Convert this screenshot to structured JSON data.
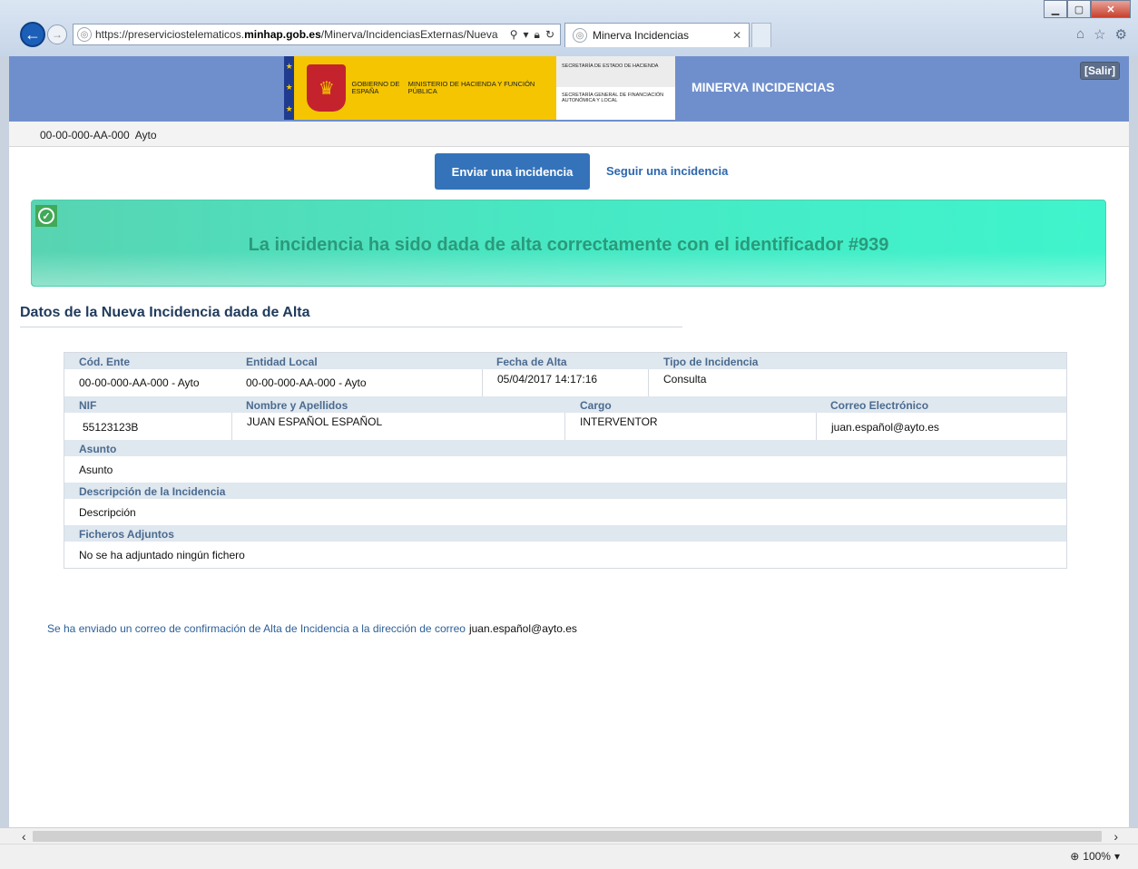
{
  "browser": {
    "url_pre": "https://preserviciostelematicos.",
    "url_host": "minhap.gob.es",
    "url_post": "/Minerva/IncidenciasExternas/Nueva",
    "tab_title": "Minerva Incidencias",
    "zoom": "100%"
  },
  "header": {
    "gobierno": "GOBIERNO DE ESPAÑA",
    "ministerio": "MINISTERIO DE HACIENDA Y FUNCIÓN PÚBLICA",
    "secretaria_estado": "SECRETARÍA DE ESTADO DE HACIENDA",
    "secretaria_general": "SECRETARÍA GENERAL DE FINANCIACIÓN AUTONÓMICA Y LOCAL",
    "app_name": "MINERVA INCIDENCIAS",
    "salir": "[Salir]"
  },
  "user": {
    "code": "00-00-000-AA-000",
    "name": "Ayto"
  },
  "actions": {
    "send_label": "Enviar una incidencia",
    "follow_label": "Seguir una incidencia"
  },
  "alert": {
    "message": "La incidencia ha sido dada de alta correctamente con el identificador #939"
  },
  "section_title": "Datos de la Nueva Incidencia dada de Alta",
  "datos": {
    "h_cod_ente": "Cód. Ente",
    "h_entidad_local": "Entidad Local",
    "h_fecha_alta": "Fecha de Alta",
    "h_tipo": "Tipo de Incidencia",
    "cod_ente": "00-00-000-AA-000 - Ayto",
    "entidad_local": "00-00-000-AA-000 - Ayto",
    "fecha_alta": "05/04/2017 14:17:16",
    "tipo": "Consulta",
    "h_nif": "NIF",
    "h_nombre": "Nombre y Apellidos",
    "h_cargo": "Cargo",
    "h_correo": "Correo Electrónico",
    "nif": "55123123B",
    "nombre": "JUAN ESPAÑOL ESPAÑOL",
    "cargo": "INTERVENTOR",
    "correo": "juan.español@ayto.es",
    "h_asunto": "Asunto",
    "asunto": "Asunto",
    "h_descripcion": "Descripción de la Incidencia",
    "descripcion": "Descripción",
    "h_ficheros": "Ficheros Adjuntos",
    "ficheros": "No se ha adjuntado ningún fichero"
  },
  "confirmation": {
    "text": "Se ha enviado un correo de confirmación de Alta de Incidencia a la dirección de correo",
    "email": "juan.español@ayto.es"
  }
}
